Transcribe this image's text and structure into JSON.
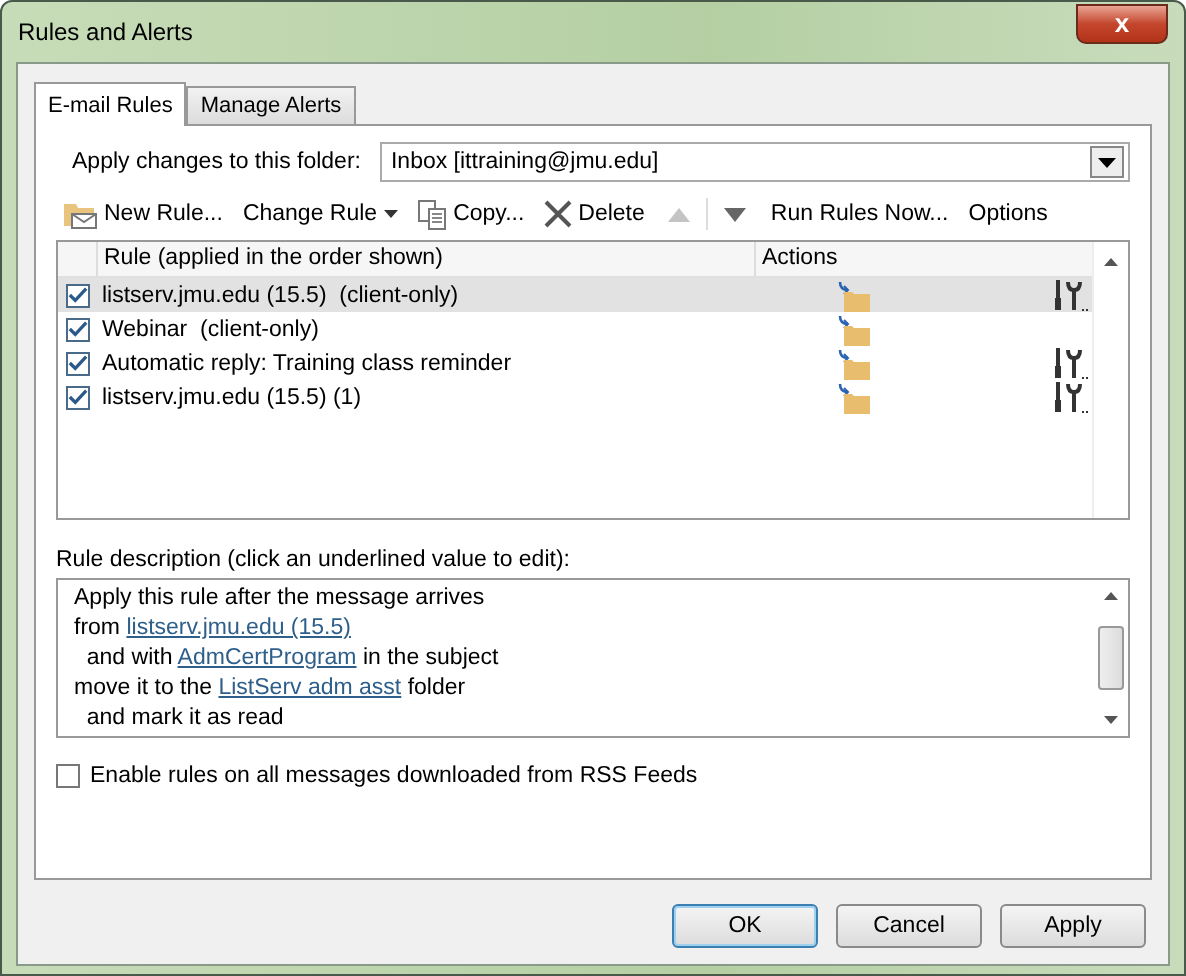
{
  "window": {
    "title": "Rules and Alerts",
    "close": "x"
  },
  "tabs": [
    {
      "label": "E-mail Rules",
      "selected": true
    },
    {
      "label": "Manage Alerts",
      "selected": false
    }
  ],
  "folder": {
    "label": "Apply changes to this folder:",
    "value": "Inbox [ittraining@jmu.edu]"
  },
  "toolbar": [
    {
      "kind": "new",
      "label": "New Rule...",
      "disabled": false
    },
    {
      "kind": "change",
      "label": "Change Rule",
      "disabled": false
    },
    {
      "kind": "copy",
      "label": "Copy...",
      "disabled": false
    },
    {
      "kind": "delete",
      "label": "Delete",
      "disabled": false
    },
    {
      "kind": "up",
      "disabled": true
    },
    {
      "kind": "down",
      "disabled": false
    },
    {
      "kind": "text",
      "label": "Run Rules Now...",
      "disabled": false
    },
    {
      "kind": "text",
      "label": "Options",
      "disabled": false
    }
  ],
  "rules_table": {
    "columns": [
      "Rule (applied in the order shown)",
      "Actions"
    ],
    "rows": [
      {
        "name": "listserv.jmu.edu (15.5)  (client-only)",
        "checked": true,
        "selected": true,
        "extra_actions": true
      },
      {
        "name": "Webinar  (client-only)",
        "checked": true,
        "selected": false,
        "extra_actions": false
      },
      {
        "name": "Automatic reply: Training class reminder",
        "checked": true,
        "selected": false,
        "extra_actions": true
      },
      {
        "name": "listserv.jmu.edu (15.5) (1)",
        "checked": true,
        "selected": false,
        "extra_actions": true
      }
    ]
  },
  "description": {
    "label": "Rule description (click an underlined value to edit):",
    "lines": [
      [
        {
          "text": "Apply this rule after the message arrives",
          "link": false
        }
      ],
      [
        {
          "text": "from ",
          "link": false
        },
        {
          "text": "listserv.jmu.edu (15.5)",
          "link": true
        }
      ],
      [
        {
          "text": "  and with ",
          "link": false
        },
        {
          "text": "AdmCertProgram",
          "link": true
        },
        {
          "text": " in the subject",
          "link": false
        }
      ],
      [
        {
          "text": "move it to the ",
          "link": false
        },
        {
          "text": "ListServ adm asst",
          "link": true
        },
        {
          "text": " folder",
          "link": false
        }
      ],
      [
        {
          "text": "  and mark it as read",
          "link": false
        }
      ]
    ]
  },
  "rss_option": {
    "label": "Enable rules on all messages downloaded from RSS Feeds",
    "checked": false
  },
  "buttons": [
    {
      "label": "OK",
      "default": true
    },
    {
      "label": "Cancel",
      "default": false
    },
    {
      "label": "Apply",
      "default": false
    }
  ]
}
